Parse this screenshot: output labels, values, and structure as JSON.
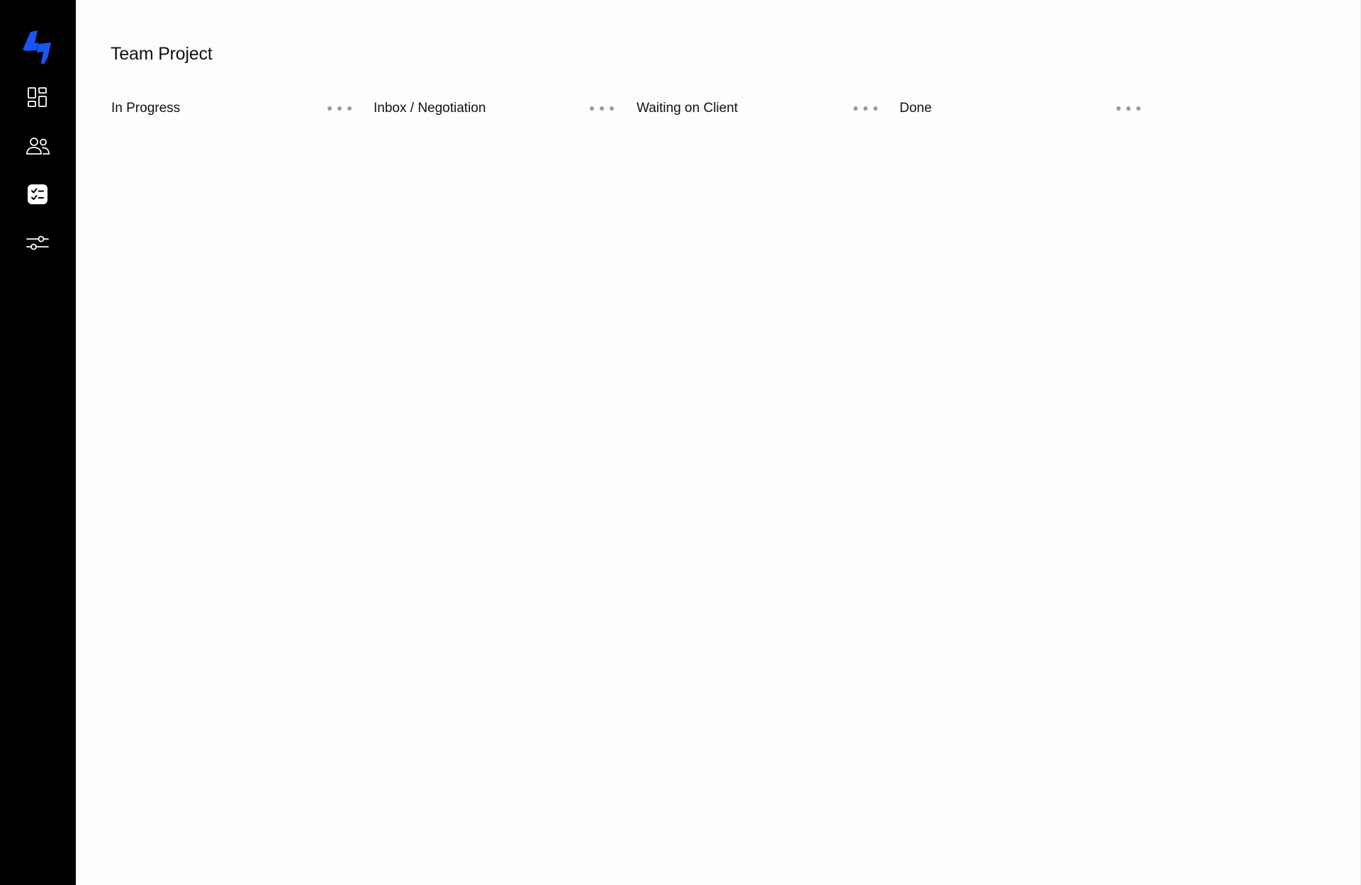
{
  "app": {
    "brand_color": "#1a56f5",
    "sidebar_bg": "#000000",
    "main_bg": "#fdfdfd"
  },
  "sidebar": {
    "logo_icon": "bolt-logo-icon",
    "items": [
      {
        "name": "dashboard",
        "icon": "dashboard-grid-icon"
      },
      {
        "name": "team",
        "icon": "users-icon"
      },
      {
        "name": "tasks",
        "icon": "checklist-icon"
      },
      {
        "name": "settings",
        "icon": "sliders-icon"
      }
    ]
  },
  "main": {
    "title": "Team Project",
    "columns": [
      {
        "title": "In Progress",
        "menu_icon": "more-horizontal-icon"
      },
      {
        "title": "Inbox / Negotiation",
        "menu_icon": "more-horizontal-icon"
      },
      {
        "title": "Waiting on Client",
        "menu_icon": "more-horizontal-icon"
      },
      {
        "title": "Done",
        "menu_icon": "more-horizontal-icon"
      }
    ]
  }
}
